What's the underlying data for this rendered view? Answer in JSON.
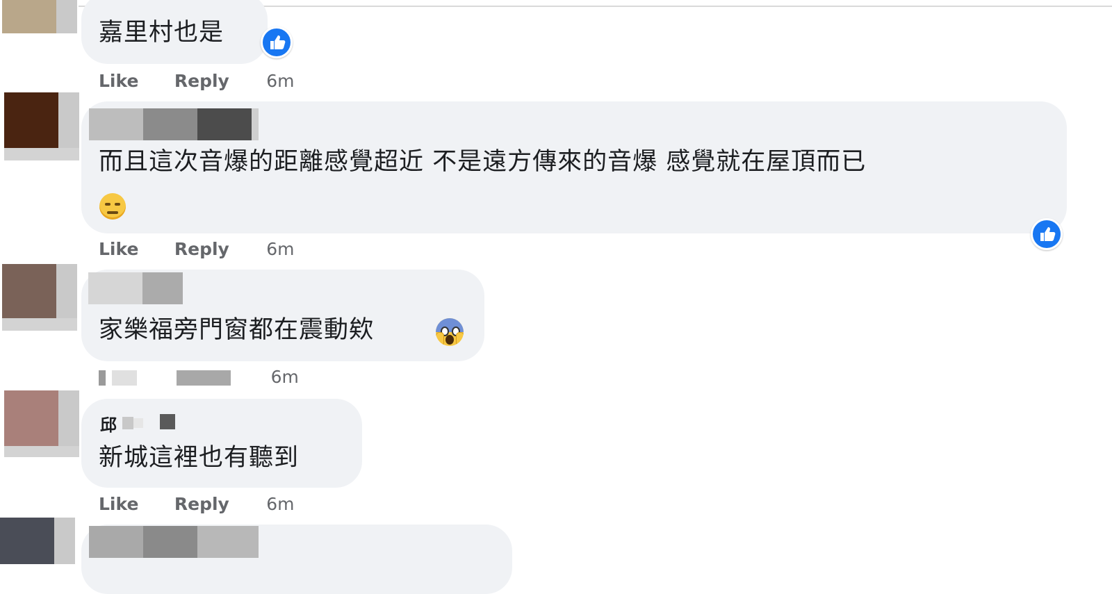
{
  "comments": [
    {
      "text": "嘉里村也是",
      "actions": {
        "like": "Like",
        "reply": "Reply",
        "time": "6m"
      },
      "avatar_colors": [
        "#b9a78a",
        "#c9c9c9"
      ]
    },
    {
      "text_line1": "而且這次音爆的距離感覺超近 不是遠方傳來的音爆 感覺就在屋頂而已",
      "emoji": "expressionless-face",
      "actions": {
        "like": "Like",
        "reply": "Reply",
        "time": "6m"
      },
      "avatar_colors": [
        "#4a2411",
        "#c9c9c9"
      ]
    },
    {
      "text": "家樂福旁門窗都在震動欸",
      "emoji": "face-screaming-in-fear",
      "actions": {
        "time": "6m"
      },
      "avatar_colors": [
        "#7a6258",
        "#c9c9c9"
      ]
    },
    {
      "name_fragment": "邱",
      "text": "新城這裡也有聽到",
      "actions": {
        "like": "Like",
        "reply": "Reply",
        "time": "6m"
      },
      "avatar_colors": [
        "#a9807a",
        "#c9c9c9"
      ]
    },
    {
      "avatar_colors": [
        "#4a4d57",
        "#c9c9c9"
      ]
    }
  ],
  "colors": {
    "bubble_bg": "#f0f2f5",
    "like_blue": "#1877f2",
    "action_gray": "#65676b"
  }
}
